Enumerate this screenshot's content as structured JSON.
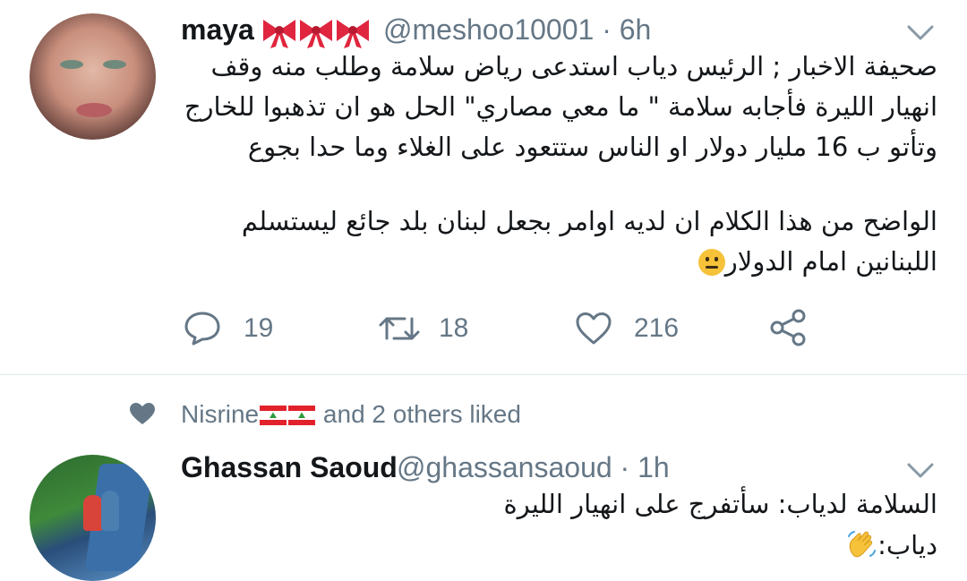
{
  "tweet1": {
    "name": "maya",
    "handle_time": "@meshoo10001 · 6h",
    "text_lines": [
      "صحيفة الاخبار ; الرئيس دياب استدعى رياض سلامة وطلب منه وقف",
      "انهيار الليرة فأجابه سلامة \" ما معي مصاري\" الحل هو ان تذهبوا للخارج",
      "وتأتو ب 16 مليار دولار او الناس ستتعود على الغلاء وما حدا بجوع",
      "الواضح من هذا الكلام ان لديه اوامر بجعل لبنان بلد جائع ليستسلم",
      "اللبنانين امام الدولار"
    ],
    "replies": "19",
    "retweets": "18",
    "likes": "216"
  },
  "liked_by": {
    "name": "Nisrine",
    "suffix": "and 2 others liked"
  },
  "tweet2": {
    "name": "Ghassan Saoud",
    "handle_time": "@ghassansaoud · 1h",
    "text_lines": [
      "السلامة لدياب: سأتفرج على انهيار الليرة",
      "دياب:"
    ]
  },
  "icons": {
    "bows": "ribbon-bow-icon",
    "flag": "lebanon-flag-icon",
    "neutral": "neutral-face-emoji-icon",
    "wave": "waving-hand-emoji-icon"
  },
  "colors": {
    "text": "#14171a",
    "secondary": "#657786",
    "divider": "#e1e8ed"
  }
}
